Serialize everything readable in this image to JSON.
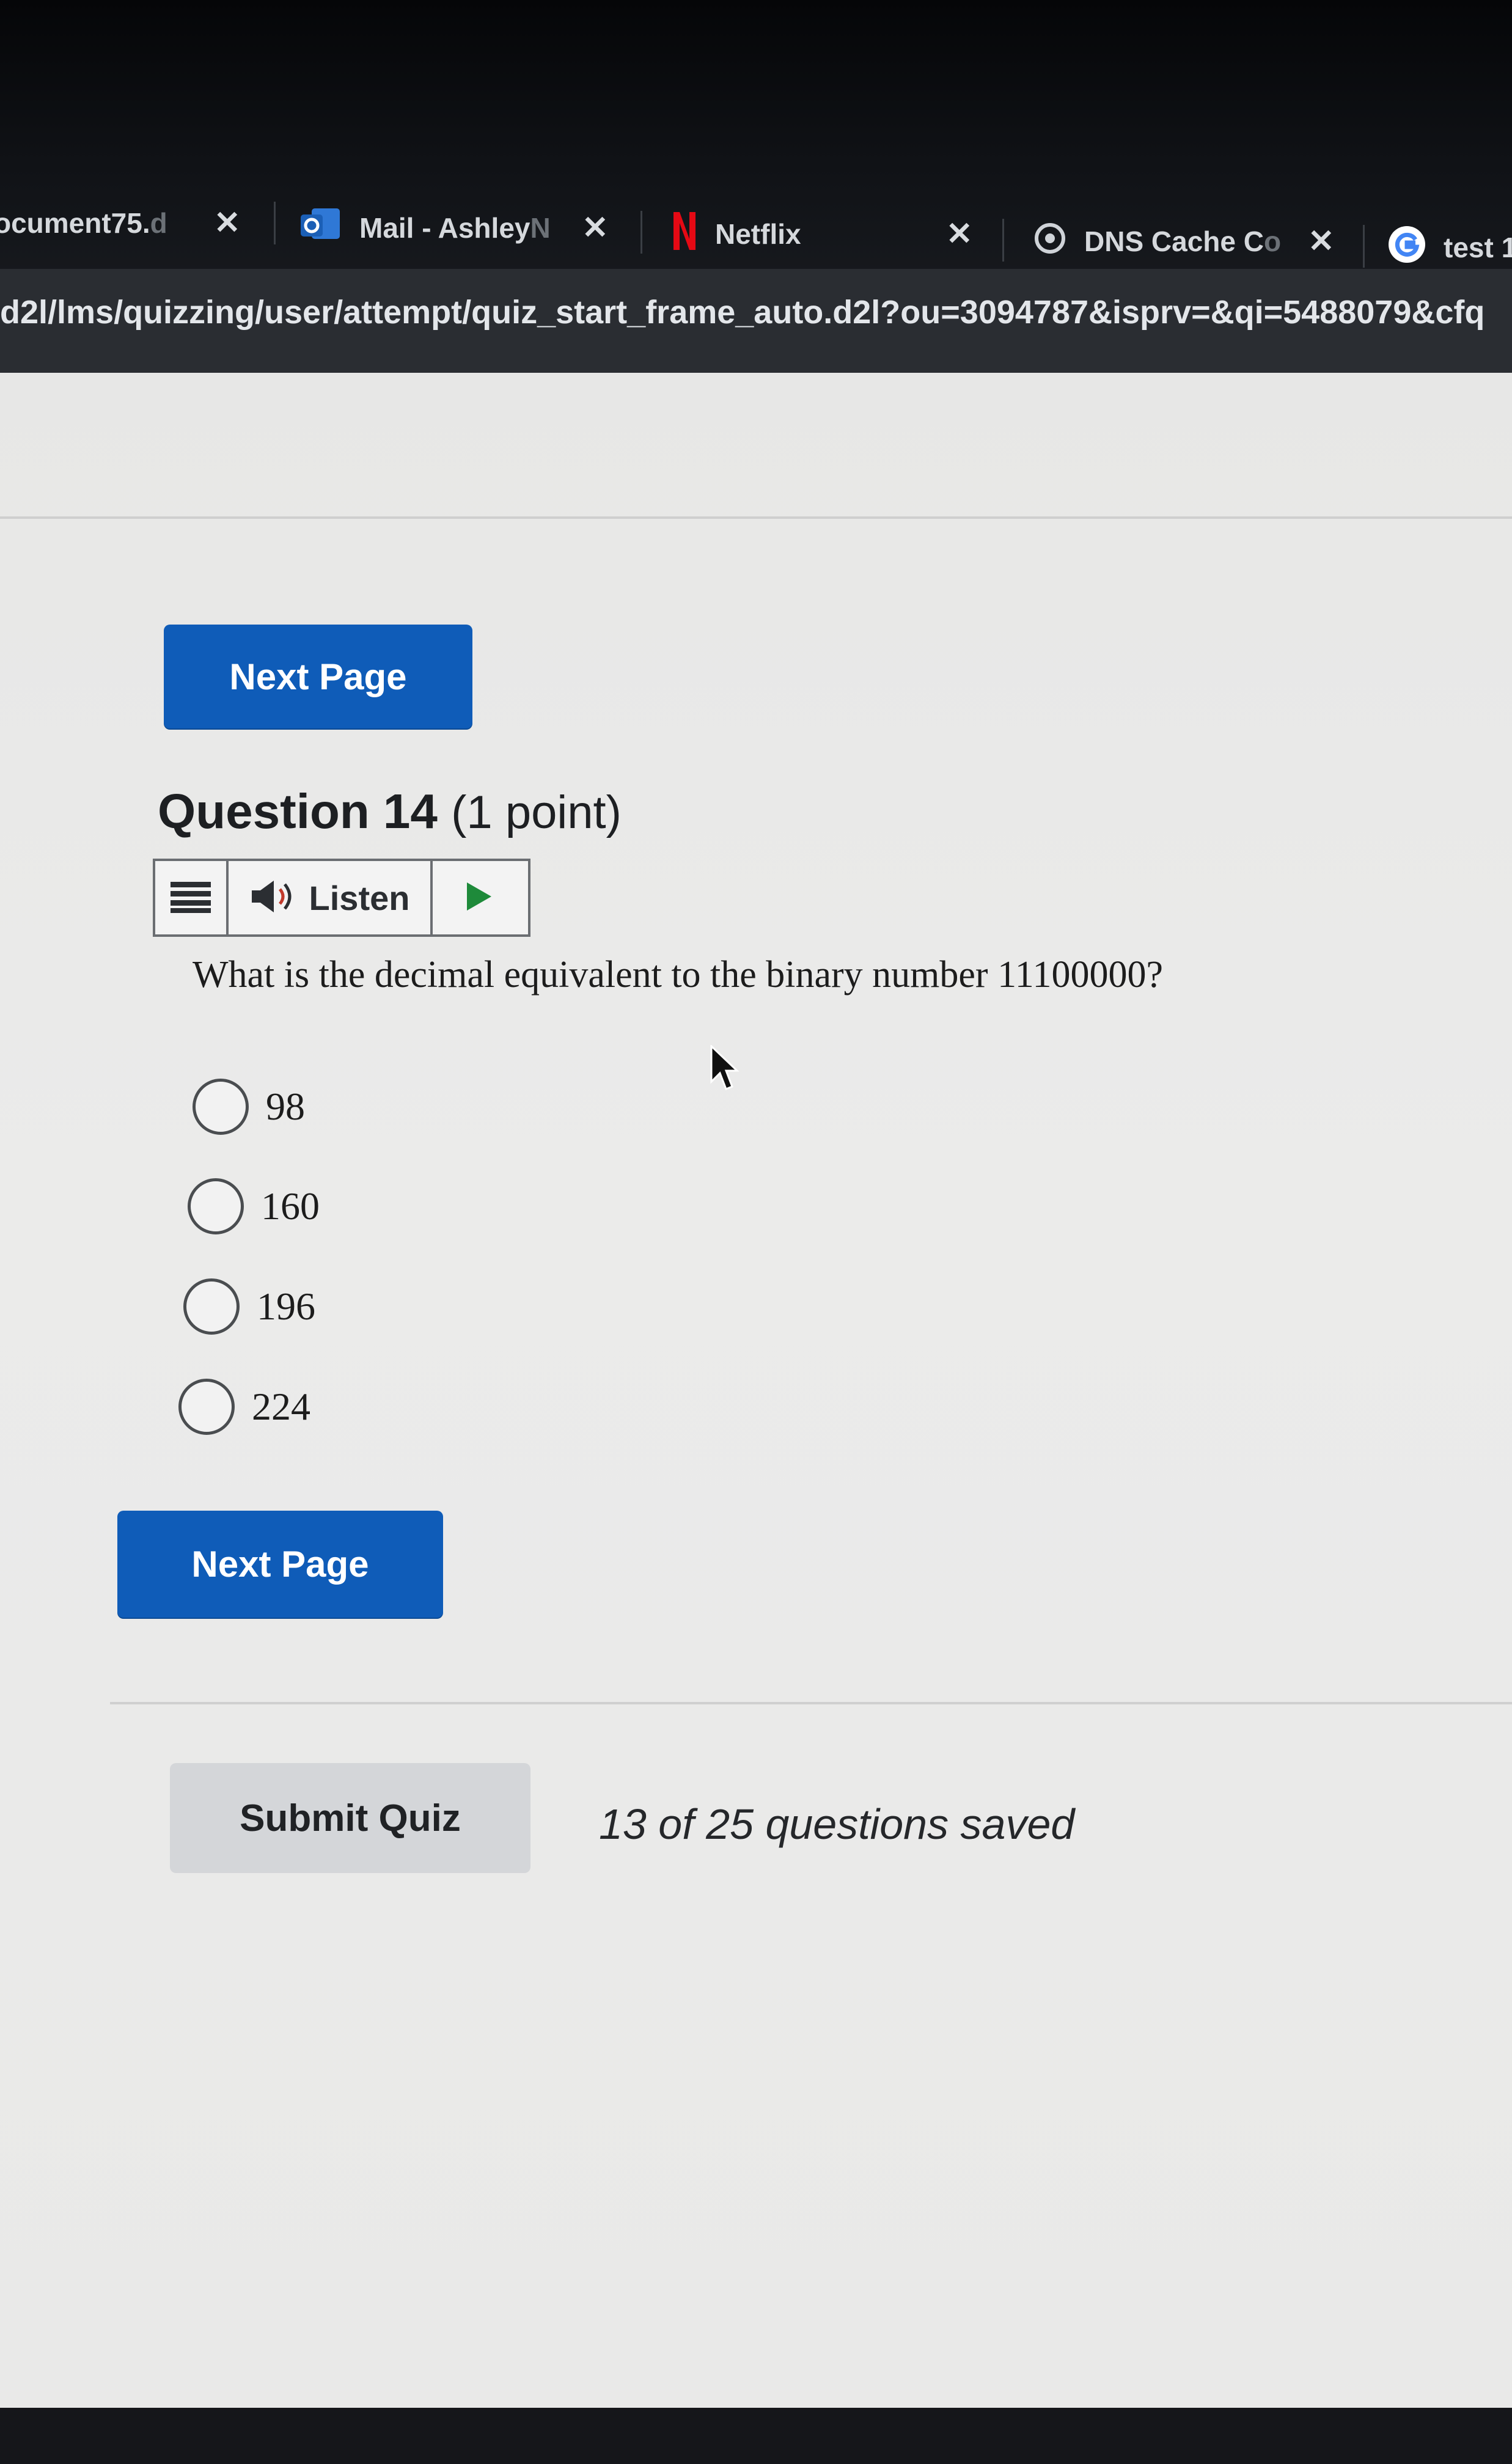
{
  "tabs": [
    {
      "title": "ocument75.",
      "faded": "d",
      "icon": "document-icon"
    },
    {
      "title": "Mail - Ashley",
      "faded": "N",
      "icon": "outlook-icon"
    },
    {
      "title": "Netflix",
      "faded": "",
      "icon": "netflix-icon"
    },
    {
      "title": "DNS Cache C",
      "faded": "o",
      "icon": "openai-icon"
    },
    {
      "title": "test 1",
      "faded": "",
      "icon": "google-icon"
    }
  ],
  "tab_close_glyph": "✕",
  "url": "d2l/lms/quizzing/user/attempt/quiz_start_frame_auto.d2l?ou=3094787&isprv=&qi=5488079&cfq",
  "quiz": {
    "next_page_label": "Next Page",
    "question_title": "Question 14",
    "question_points": "(1 point)",
    "listen_label": "Listen",
    "question_text": "What is the decimal equivalent to the binary number 11100000?",
    "options": [
      "98",
      "160",
      "196",
      "224"
    ],
    "submit_label": "Submit Quiz",
    "saved_status": "13 of 25 questions saved"
  },
  "colors": {
    "primary_button": "#0f5cb8",
    "page_background": "#e9e9e8",
    "chrome_background": "#1e2126",
    "netflix_red": "#e50914"
  }
}
